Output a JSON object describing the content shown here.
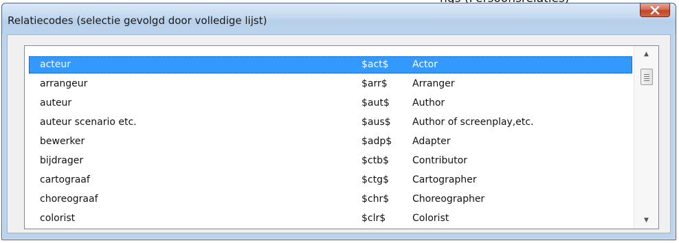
{
  "background": {
    "partial_text": "ngs (Persoonsrelaties)"
  },
  "window": {
    "title": "Relatiecodes (selectie gevolgd door volledige lijst)",
    "close_icon": "close-x-icon"
  },
  "list": {
    "rows": [
      {
        "dutch": "acteur",
        "code": "$act$",
        "english": "Actor",
        "selected": true
      },
      {
        "dutch": "arrangeur",
        "code": "$arr$",
        "english": "Arranger"
      },
      {
        "dutch": "auteur",
        "code": "$aut$",
        "english": "Author"
      },
      {
        "dutch": "auteur scenario etc.",
        "code": "$aus$",
        "english": "Author of screenplay,etc."
      },
      {
        "dutch": "bewerker",
        "code": "$adp$",
        "english": "Adapter"
      },
      {
        "dutch": "bijdrager",
        "code": "$ctb$",
        "english": "Contributor"
      },
      {
        "dutch": "cartograaf",
        "code": "$ctg$",
        "english": "Cartographer"
      },
      {
        "dutch": "choreograaf",
        "code": "$chr$",
        "english": "Choreographer"
      },
      {
        "dutch": "colorist",
        "code": "$clr$",
        "english": "Colorist"
      }
    ]
  },
  "scrollbar": {
    "up_icon": "scroll-up-arrow-icon",
    "down_icon": "scroll-down-arrow-icon"
  },
  "colors": {
    "selection": "#3399ff",
    "close_button": "#c1442a",
    "frame": "#bcd3ec"
  }
}
